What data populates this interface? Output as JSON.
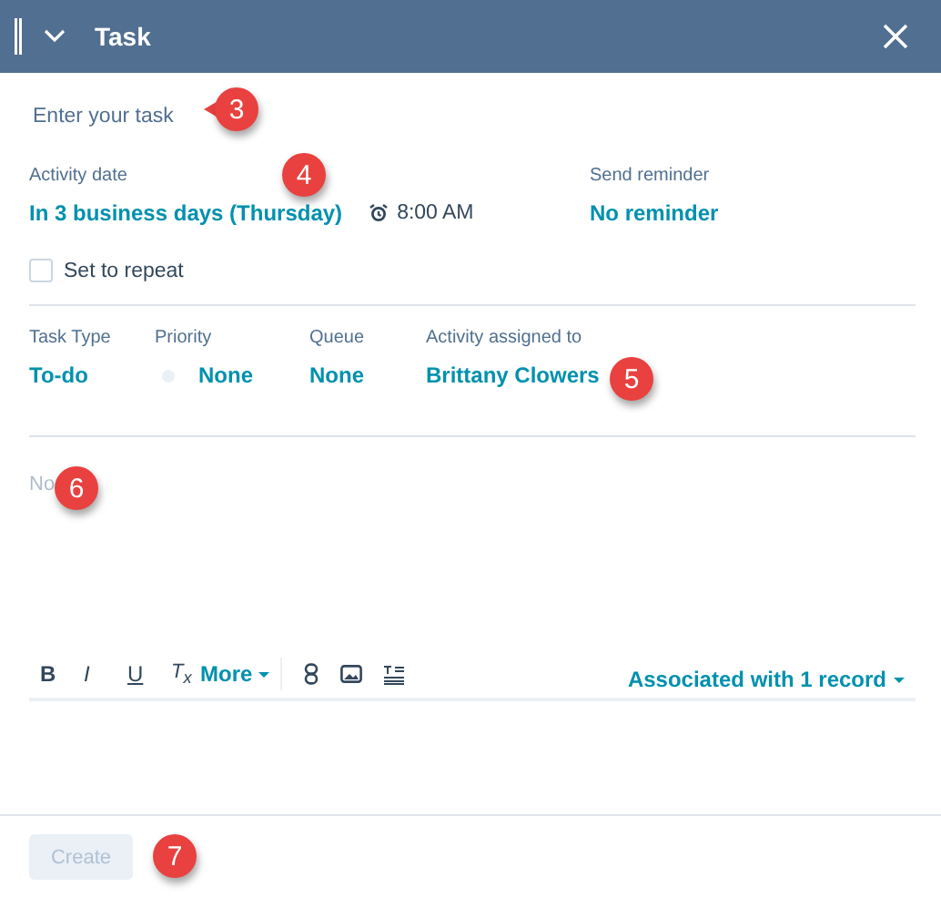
{
  "window": {
    "title": "Task",
    "expanded": true
  },
  "task_field": {
    "placeholder": "Enter your task"
  },
  "schedule": [
    {
      "kind": "date",
      "label": "Activity date",
      "value": "In 3 business days (Thursday)",
      "time": "8:00 AM"
    },
    {
      "kind": "reminder",
      "label": "Send reminder",
      "value": "No reminder"
    }
  ],
  "repeat": {
    "label": "Set to repeat",
    "checked": false
  },
  "fields": [
    {
      "kind": "text",
      "label": "Task Type",
      "value": "To-do"
    },
    {
      "kind": "priority",
      "label": "Priority",
      "value": "None"
    },
    {
      "kind": "text",
      "label": "Queue",
      "value": "None"
    },
    {
      "kind": "text",
      "label": "Activity assigned to",
      "value": "Brittany Clowers"
    }
  ],
  "notes": {
    "placeholder": "No"
  },
  "toolbar": {
    "formats": [
      {
        "kind": "bold",
        "label": "B"
      },
      {
        "kind": "italic",
        "label": "I"
      },
      {
        "kind": "underline",
        "label": "U"
      },
      {
        "kind": "clear",
        "label": "T$_{x}$"
      }
    ],
    "more": "More",
    "associations": "Associated with 1 record"
  },
  "create_button": {
    "label": "Create",
    "disabled": true
  },
  "callouts": [
    {
      "kind": "pointer",
      "label": "3"
    },
    {
      "kind": "dot",
      "label": "4"
    },
    {
      "kind": "dot",
      "label": "5"
    },
    {
      "kind": "dot",
      "label": "6"
    },
    {
      "kind": "dot",
      "label": "7"
    }
  ]
}
